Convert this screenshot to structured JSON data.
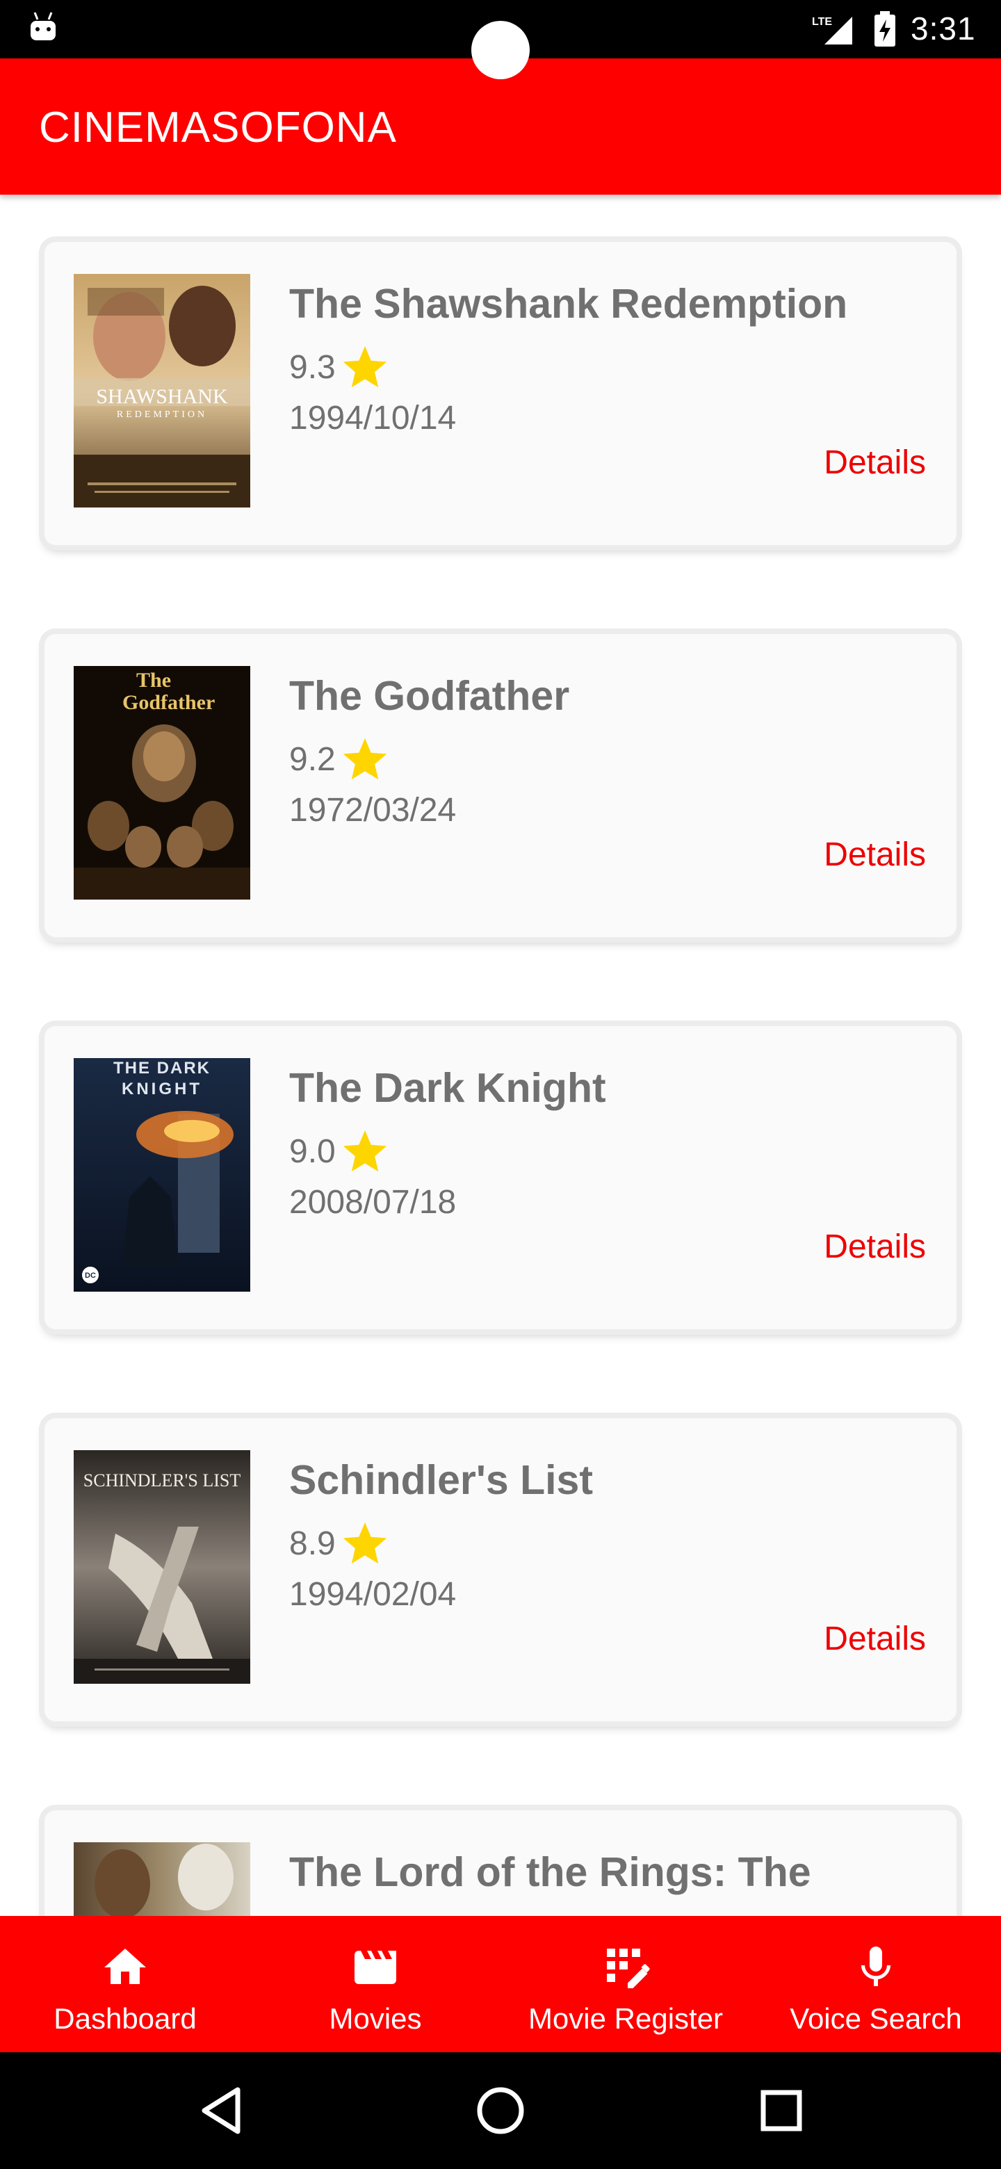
{
  "status_bar": {
    "network_label": "LTE",
    "time": "3:31",
    "icons": [
      "android-icon",
      "lte-signal-icon",
      "battery-charging-icon"
    ]
  },
  "app_bar": {
    "title": "CINEMASOFONA"
  },
  "colors": {
    "primary": "#ff0000",
    "text_gray": "#707070",
    "star": "#ffd500",
    "details": "#ee0000"
  },
  "movies": [
    {
      "title": "The Shawshank Redemption",
      "rating": "9.3",
      "date": "1994/10/14",
      "details_label": "Details"
    },
    {
      "title": "The Godfather",
      "rating": "9.2",
      "date": "1972/03/24",
      "details_label": "Details"
    },
    {
      "title": "The Dark Knight",
      "rating": "9.0",
      "date": "2008/07/18",
      "details_label": "Details"
    },
    {
      "title": "Schindler's List",
      "rating": "8.9",
      "date": "1994/02/04",
      "details_label": "Details"
    },
    {
      "title": "The Lord of the Rings: The",
      "rating": "",
      "date": "",
      "details_label": ""
    }
  ],
  "posters": {
    "shawshank": {
      "title_text": "SHAWSHANK",
      "subtitle_text": "REDEMPTION"
    },
    "godfather": {
      "title_line1": "The",
      "title_line2": "Godfather"
    },
    "dark_knight": {
      "title_line1": "THE DARK",
      "title_line2": "KNIGHT",
      "badge": "DC"
    },
    "schindler": {
      "title_text": "SCHINDLER'S LIST"
    }
  },
  "bottom_nav": {
    "items": [
      {
        "label": "Dashboard",
        "icon": "home-icon"
      },
      {
        "label": "Movies",
        "icon": "movie-clapper-icon"
      },
      {
        "label": "Movie Register",
        "icon": "register-edit-icon"
      },
      {
        "label": "Voice Search",
        "icon": "microphone-icon"
      }
    ]
  },
  "system_nav": {
    "icons": [
      "back-icon",
      "home-circle-icon",
      "recents-icon"
    ]
  }
}
